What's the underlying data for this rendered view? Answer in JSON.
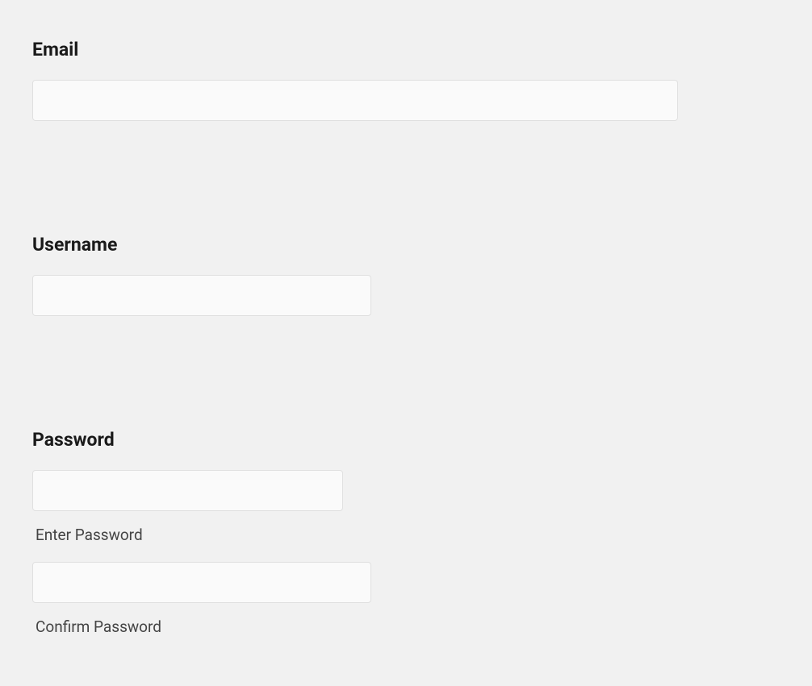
{
  "form": {
    "email": {
      "label": "Email",
      "value": ""
    },
    "username": {
      "label": "Username",
      "value": ""
    },
    "password": {
      "label": "Password",
      "enter": {
        "value": "",
        "sublabel": "Enter Password"
      },
      "confirm": {
        "value": "",
        "sublabel": "Confirm Password"
      }
    }
  }
}
